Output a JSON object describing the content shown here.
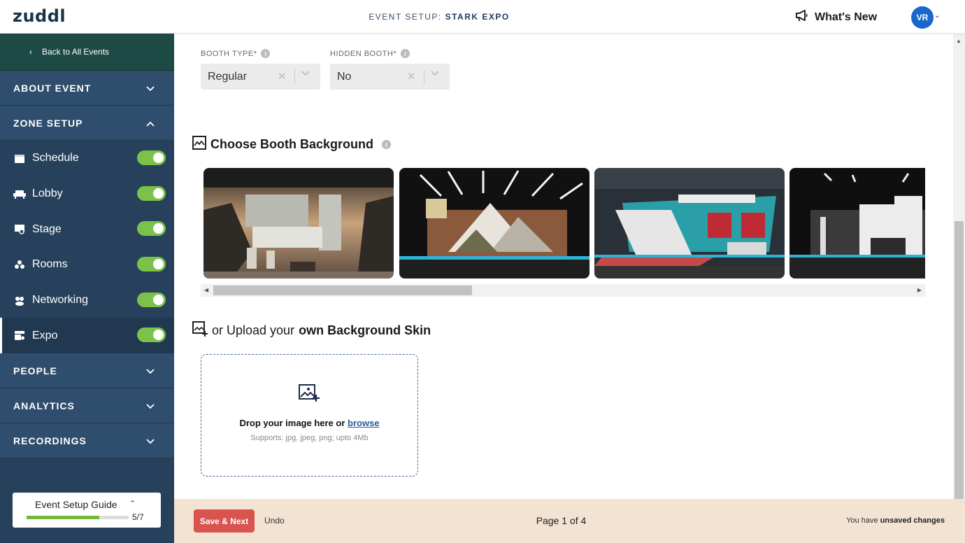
{
  "brand": {
    "logo": "zuddl"
  },
  "header": {
    "event_prefix": "EVENT SETUP:",
    "event_name": "STARK EXPO",
    "whats_new": "What's New",
    "avatar_initials": "VR"
  },
  "sidebar": {
    "back_label": "Back to All Events",
    "sections": {
      "about": "ABOUT EVENT",
      "zone": "ZONE SETUP",
      "people": "PEOPLE",
      "analytics": "ANALYTICS",
      "recordings": "RECORDINGS"
    },
    "zones": [
      {
        "label": "Schedule",
        "icon": "calendar-icon",
        "enabled": true
      },
      {
        "label": "Lobby",
        "icon": "sofa-icon",
        "enabled": true
      },
      {
        "label": "Stage",
        "icon": "stage-icon",
        "enabled": true
      },
      {
        "label": "Rooms",
        "icon": "rooms-icon",
        "enabled": true
      },
      {
        "label": "Networking",
        "icon": "networking-icon",
        "enabled": true
      },
      {
        "label": "Expo",
        "icon": "expo-icon",
        "enabled": true,
        "active": true
      }
    ],
    "guide": {
      "label": "Event Setup Guide",
      "count": "5/7",
      "progress": 0.71
    }
  },
  "form": {
    "booth_type_label": "BOOTH TYPE*",
    "booth_type_value": "Regular",
    "hidden_booth_label": "HIDDEN BOOTH*",
    "hidden_booth_value": "No",
    "choose_bg_heading": "Choose Booth Background",
    "upload_prefix": "or Upload your",
    "upload_bold": "own Background Skin",
    "drop_text": "Drop your image here or",
    "browse": "browse",
    "supports": "Supports: jpg, jpeg, png; upto 4Mb"
  },
  "footer": {
    "save": "Save & Next",
    "undo": "Undo",
    "page": "Page 1 of 4",
    "unsaved_prefix": "You have",
    "unsaved_bold": "unsaved changes"
  },
  "colors": {
    "sidebar": "#27415c",
    "toggle_on": "#7bc24a",
    "accent_red": "#d9534f",
    "footer_bg": "#f2e3d2",
    "avatar": "#1a66c9"
  }
}
